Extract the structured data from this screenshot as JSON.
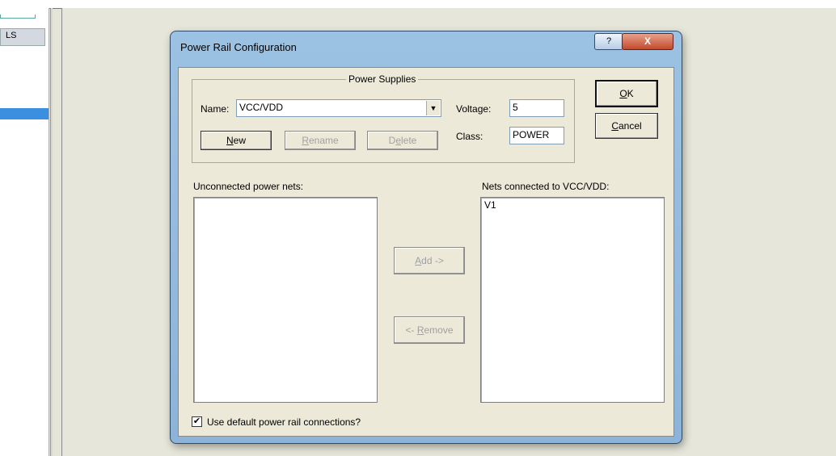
{
  "left_panel": {
    "tab_label": "LS"
  },
  "dialog": {
    "title": "Power Rail Configuration",
    "help_button": "?",
    "close_button": "X",
    "power_supplies": {
      "group_title": "Power Supplies",
      "name_label": "Name:",
      "name_value": "VCC/VDD",
      "voltage_label": "Voltage:",
      "voltage_value": "5",
      "class_label": "Class:",
      "class_value": "POWER",
      "new_label_u": "N",
      "new_label_rest": "ew",
      "rename_label_u": "R",
      "rename_label_rest": "ename",
      "delete_label_pre": "D",
      "delete_label_u": "e",
      "delete_label_rest": "lete"
    },
    "ok_label_u": "O",
    "ok_label_rest": "K",
    "cancel_label_u": "C",
    "cancel_label_rest": "ancel",
    "unconnected_label": "Unconnected power nets:",
    "unconnected_items": [],
    "connected_label": "Nets connected to VCC/VDD:",
    "connected_items": [
      "V1"
    ],
    "add_label_u": "A",
    "add_label_rest": "dd ->",
    "remove_label_pre": "<- ",
    "remove_label_u": "R",
    "remove_label_rest": "emove",
    "default_rail_checkbox": {
      "checked": true,
      "mark": "✔",
      "label": "Use default power rail connections?"
    }
  }
}
